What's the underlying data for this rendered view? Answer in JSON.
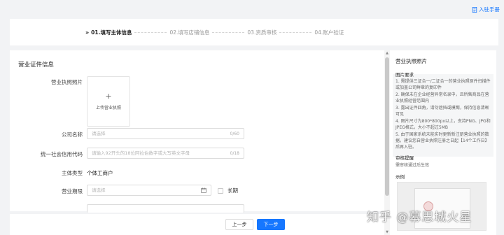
{
  "header": {
    "manual_link": "入驻手册"
  },
  "steps": [
    {
      "label": "01.填写主体信息",
      "active": true
    },
    {
      "label": "02.填写店铺信息",
      "active": false
    },
    {
      "label": "03.资质审核",
      "active": false
    },
    {
      "label": "04.账户验证",
      "active": false
    }
  ],
  "form": {
    "section_title": "营业证件信息",
    "license_photo_label": "营业执照照片",
    "upload_plus": "+",
    "upload_text": "上传营业执照",
    "company_name_label": "公司名称",
    "company_name_placeholder": "请选择",
    "company_name_count": "0/60",
    "credit_code_label": "统一社会信用代码",
    "credit_code_placeholder": "请输入92开头的18位阿拉伯数字或大写英文字母",
    "credit_code_count": "0/18",
    "entity_type_label": "主体类型",
    "entity_type_value": "个体工商户",
    "business_term_label": "营业期限",
    "business_term_placeholder": "请选择",
    "long_term_label": "长期"
  },
  "side_panel": {
    "title": "营业执照照片",
    "requirements_title": "图片要求",
    "requirements": [
      "1. 需提供三证合一/二证合一的营业执照原件扫描件或加盖公司鲜章的复印件",
      "2. 确保未在企业经营异常名录中，且所售商品在营业执照经营范围内",
      "3. 露出证件四角，请勿遮挡或模糊，保持信息清晰可见",
      "4. 图片尺寸为800*800px以上，支持PNG、JPG和JPEG格式，大小不超过5MB",
      "5. 由于国家系统未能实时更新新注册营业执照的数据，建议您自营业执照注册之日起【14个工作日】后再入驻。"
    ],
    "review_title": "审核提醒",
    "review_text": "需审核通过后生效",
    "sample_title": "示例"
  },
  "buttons": {
    "prev": "上一步",
    "next": "下一步"
  },
  "watermark": "知乎 @幕思城火星",
  "colors": {
    "primary": "#1677ff",
    "background": "#f2f3f5"
  }
}
